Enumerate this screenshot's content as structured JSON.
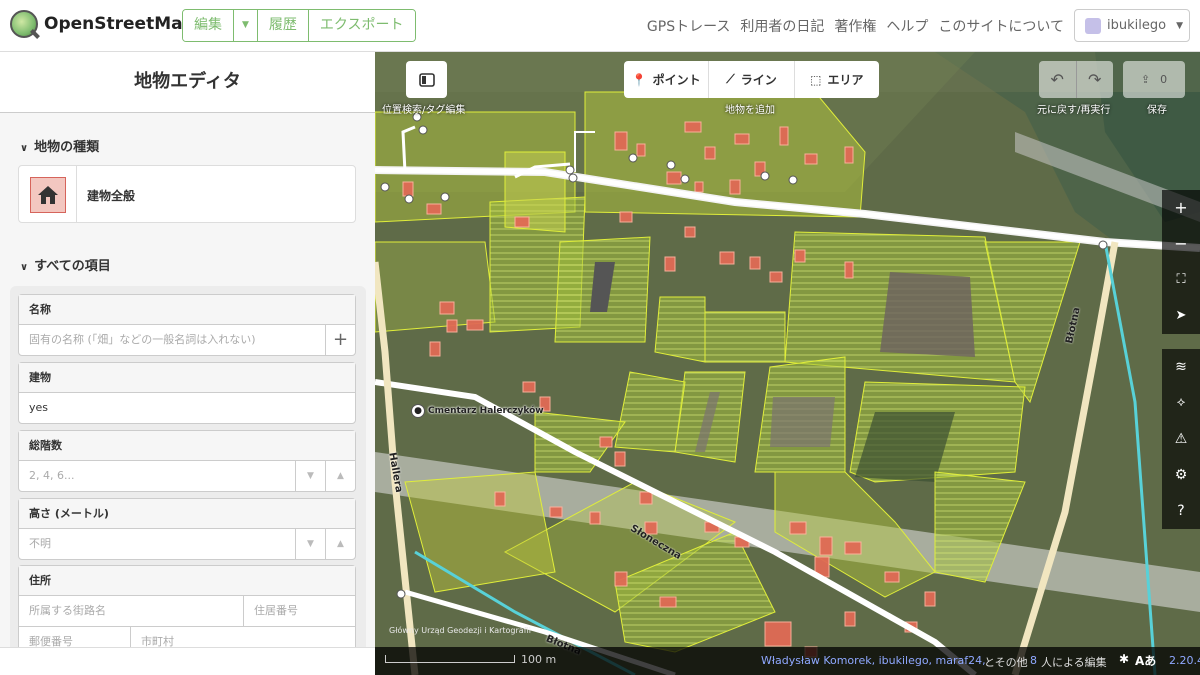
{
  "topbar": {
    "logo_text": "OpenStreetMap",
    "edit_label": "編集",
    "edit_caret": "▼",
    "history_label": "履歴",
    "export_label": "エクスポート",
    "nav": [
      "GPSトレース",
      "利用者の日記",
      "著作権",
      "ヘルプ",
      "このサイトについて"
    ],
    "username": "ibukilego"
  },
  "sidebar": {
    "title": "地物エディタ",
    "feature_type_heading": "地物の種類",
    "feature_type_label": "建物全般",
    "all_fields_heading": "すべての項目",
    "fields": {
      "name_label": "名称",
      "name_placeholder": "固有の名称 (「畑」などの一般名詞は入れない)",
      "building_label": "建物",
      "building_value": "yes",
      "levels_label": "総階数",
      "levels_placeholder": "2, 4, 6...",
      "height_label": "高さ (メートル)",
      "height_placeholder": "不明",
      "address_label": "住所",
      "street_placeholder": "所属する街路名",
      "housenumber_placeholder": "住居番号",
      "postcode_placeholder": "郵便番号",
      "city_placeholder": "市町村"
    }
  },
  "map": {
    "toolbar": {
      "inspect_label": "位置検索/タグ編集",
      "point_label": "ポイント",
      "line_label": "ライン",
      "area_label": "エリア",
      "add_feature_label": "地物を追加",
      "undo_redo_label": "元に戻す/再実行",
      "save_label": "保存",
      "save_count": "0"
    },
    "labels": {
      "cemetery": "Cmentarz Halerczyków",
      "street1": "Słoneczna",
      "street2": "Błotna",
      "street3": "Hallera",
      "street4": "Błotna"
    },
    "footer": {
      "imagery": "Główny Urząd Geodezji i Kartografii",
      "scale": "100 m",
      "contributors": "Władysław Komorek, ibukilego, maraf24,",
      "others": "とその他",
      "others_count": "8",
      "others_suffix": "人による編集",
      "version": "2.20.4"
    }
  }
}
